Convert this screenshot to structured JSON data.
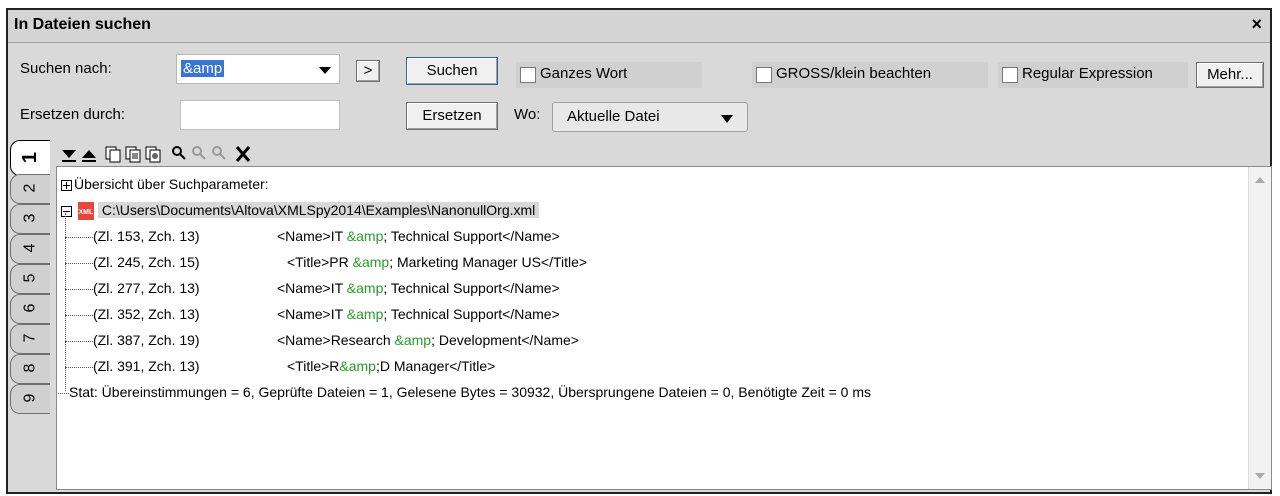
{
  "title": "In Dateien suchen",
  "close_glyph": "×",
  "search": {
    "find_label": "Suchen nach:",
    "find_value": "&amp",
    "replace_label": "Ersetzen durch:",
    "replace_value": "",
    "expand_glyph": ">",
    "search_button": "Suchen",
    "replace_button": "Ersetzen",
    "where_label": "Wo:",
    "where_value": "Aktuelle Datei",
    "more_button": "Mehr..."
  },
  "options": {
    "whole_word": "Ganzes Wort",
    "match_case": "GROSS/klein beachten",
    "regex": "Regular Expression"
  },
  "tabs": [
    "1",
    "2",
    "3",
    "4",
    "5",
    "6",
    "7",
    "8",
    "9"
  ],
  "results": {
    "overview": "Übersicht über Suchparameter:",
    "file_path": "C:\\Users\\Documents\\Altova\\XMLSpy2014\\Examples\\NanonullOrg.xml",
    "file_icon_text": "XML",
    "matches": [
      {
        "loc": "(Zl. 153, Zch. 13)",
        "pre": "<Name>IT ",
        "hit": "&amp",
        "post": "; Technical Support</Name>"
      },
      {
        "loc": "(Zl. 245, Zch. 15)",
        "pre": "<Title>PR ",
        "hit": "&amp",
        "post": "; Marketing Manager US</Title>"
      },
      {
        "loc": "(Zl. 277, Zch. 13)",
        "pre": "<Name>IT ",
        "hit": "&amp",
        "post": "; Technical Support</Name>"
      },
      {
        "loc": "(Zl. 352, Zch. 13)",
        "pre": "<Name>IT ",
        "hit": "&amp",
        "post": "; Technical Support</Name>"
      },
      {
        "loc": "(Zl. 387, Zch. 19)",
        "pre": "<Name>Research ",
        "hit": "&amp",
        "post": "; Development</Name>"
      },
      {
        "loc": "(Zl. 391, Zch. 13)",
        "pre": "<Title>R",
        "hit": "&amp",
        "post": ";D Manager</Title>"
      }
    ],
    "stat": "Stat: Übereinstimmungen = 6, Geprüfte Dateien = 1, Gelesene Bytes = 30932, Übersprungene Dateien = 0, Benötigte Zeit = 0 ms"
  },
  "colors": {
    "highlight": "#2a9a2a",
    "selection": "#3a74d6",
    "xml_icon": "#e8453c"
  }
}
